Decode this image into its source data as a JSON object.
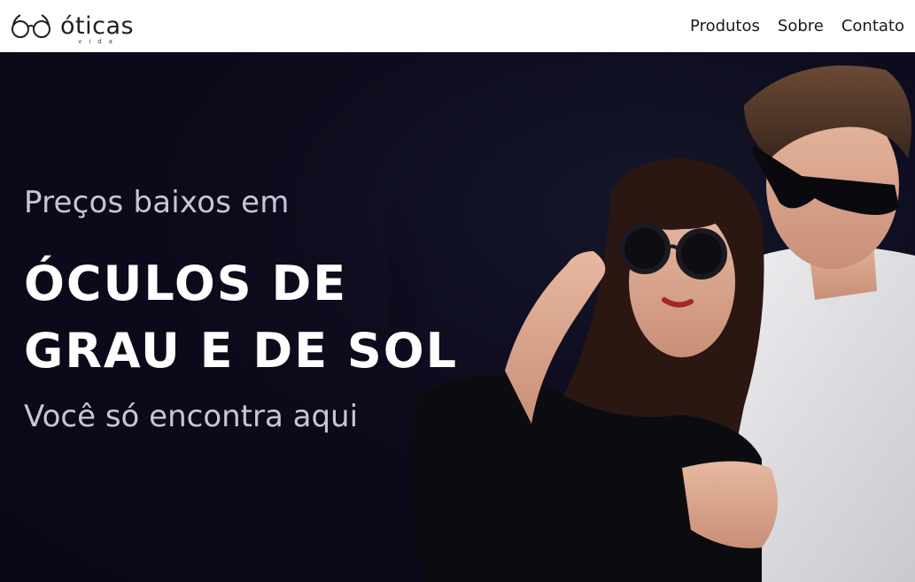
{
  "brand": {
    "name": "óticas",
    "sub": "vida",
    "icon": "glasses-icon"
  },
  "nav": {
    "items": [
      "Produtos",
      "Sobre",
      "Contato"
    ]
  },
  "hero": {
    "pre": "Preços baixos em",
    "headline_line1": "ÓCULOS DE",
    "headline_line2": "GRAU E DE SOL",
    "sub": "Você só encontra aqui"
  },
  "colors": {
    "hero_bg": "#0b0b1c",
    "text_muted": "#c9c5d4",
    "headline": "#ffffff",
    "nav_text": "#1a1a1a"
  }
}
